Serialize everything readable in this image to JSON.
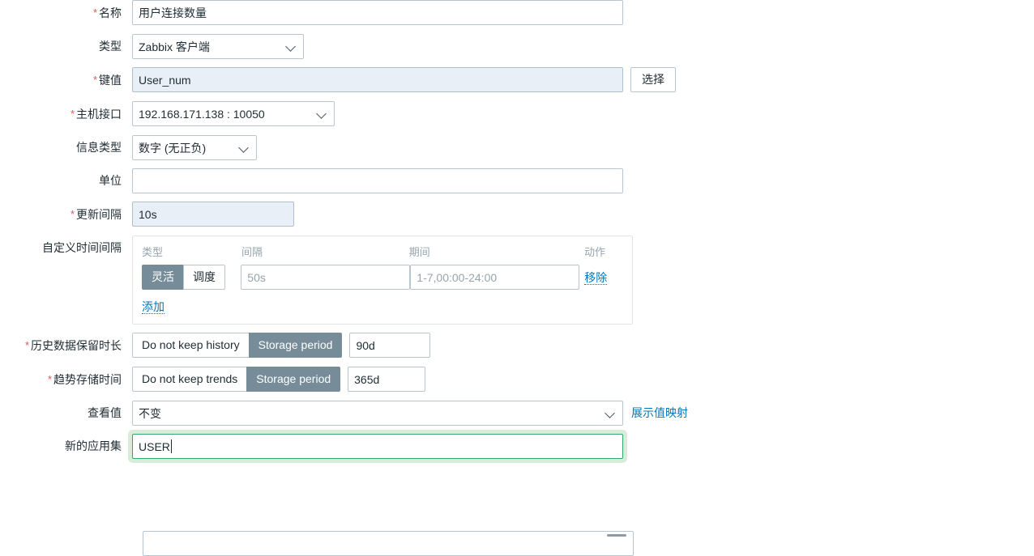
{
  "form": {
    "rows": {
      "name": {
        "label": "名称",
        "required": true,
        "value": "用户连接数量"
      },
      "type": {
        "label": "类型",
        "required": false,
        "value": "Zabbix 客户端"
      },
      "key": {
        "label": "键值",
        "required": true,
        "value": "User_num",
        "select_button": "选择"
      },
      "host_interface": {
        "label": "主机接口",
        "required": true,
        "value": "192.168.171.138 : 10050"
      },
      "info_type": {
        "label": "信息类型",
        "required": false,
        "value": "数字 (无正负)"
      },
      "units": {
        "label": "单位",
        "required": false,
        "value": "",
        "placeholder": ""
      },
      "update_interval": {
        "label": "更新间隔",
        "required": true,
        "value": "10s"
      },
      "custom_intervals": {
        "label": "自定义时间间隔",
        "required": false,
        "headers": {
          "type": "类型",
          "interval": "间隔",
          "period": "期间",
          "action": "动作"
        },
        "rows": [
          {
            "type_options": [
              "灵活",
              "调度"
            ],
            "type_selected": "灵活",
            "interval_value": "",
            "interval_placeholder": "50s",
            "period_value": "",
            "period_placeholder": "1-7,00:00-24:00",
            "remove_label": "移除"
          }
        ],
        "add_label": "添加"
      },
      "history": {
        "label": "历史数据保留时长",
        "required": true,
        "options": [
          "Do not keep history",
          "Storage period"
        ],
        "selected": "Storage period",
        "value": "90d"
      },
      "trends": {
        "label": "趋势存储时间",
        "required": true,
        "options": [
          "Do not keep trends",
          "Storage period"
        ],
        "selected": "Storage period",
        "value": "365d"
      },
      "value_mapping": {
        "label": "查看值",
        "required": false,
        "value": "不变",
        "link_label": "展示值映射"
      },
      "new_application": {
        "label": "新的应用集",
        "required": false,
        "value": "USER",
        "focused": true
      }
    }
  },
  "colors": {
    "accent_link": "#0275b8",
    "selected_toggle_bg": "#768d99",
    "required_marker": "#d45c5c",
    "highlight_field_bg": "#e8eff7",
    "focus_ring": "#d9ecd9",
    "focus_border": "#34a56f"
  }
}
